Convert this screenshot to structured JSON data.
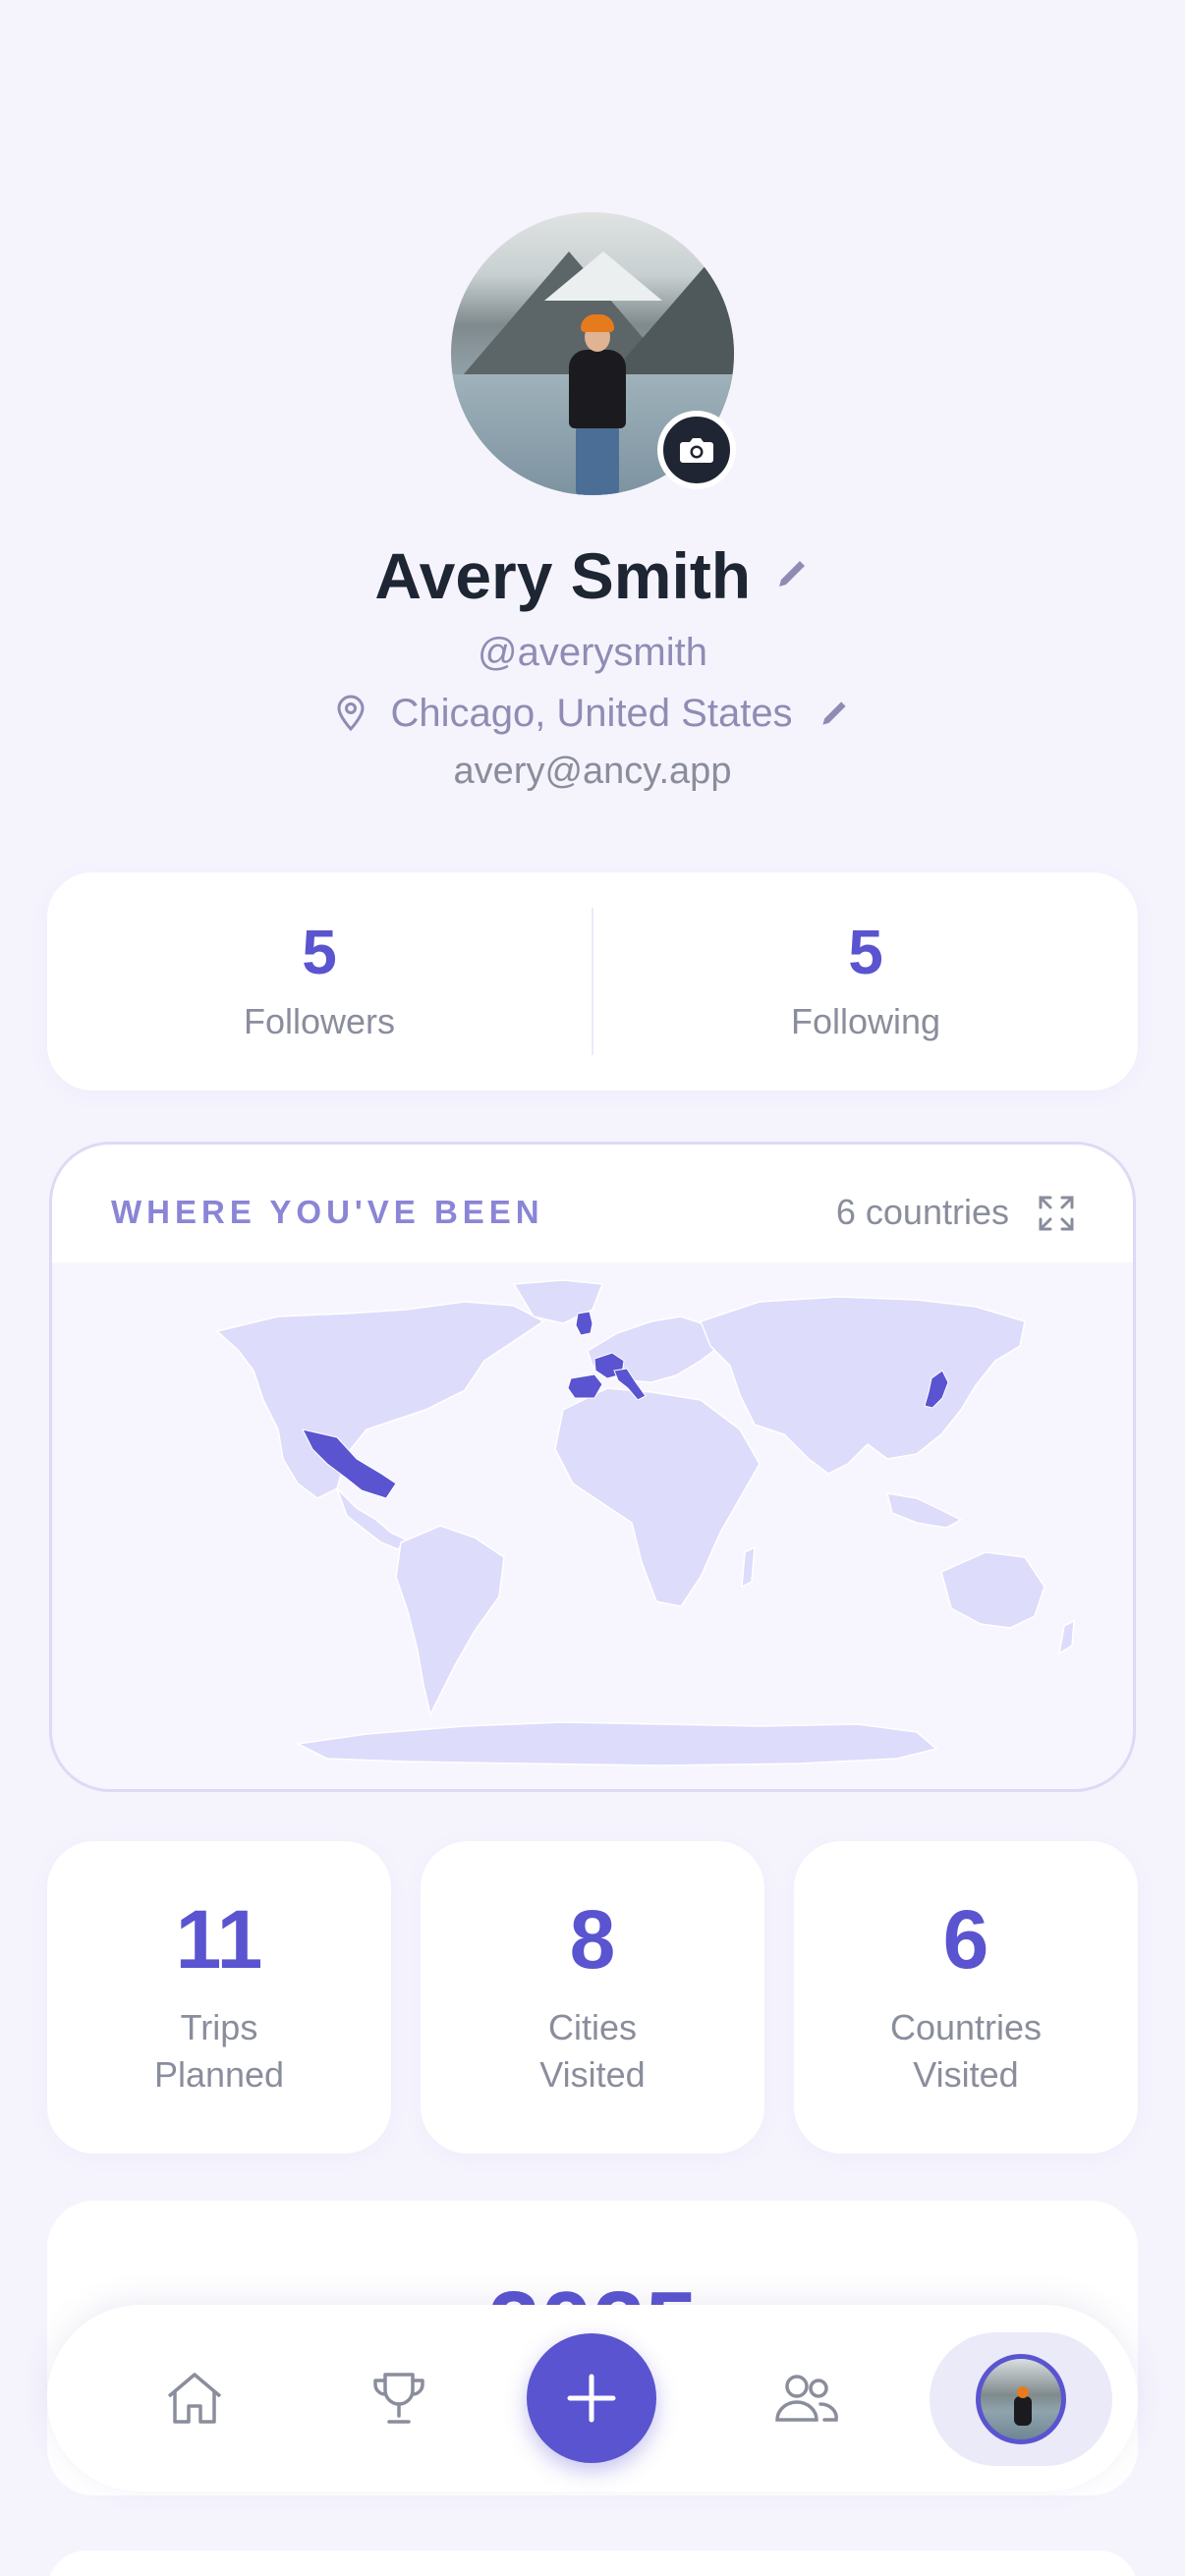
{
  "profile": {
    "name": "Avery Smith",
    "handle": "@averysmith",
    "location": "Chicago, United States",
    "email": "avery@ancy.app"
  },
  "social": {
    "followers_count": "5",
    "followers_label": "Followers",
    "following_count": "5",
    "following_label": "Following"
  },
  "map": {
    "title": "WHERE YOU'VE BEEN",
    "count_label": "6 countries",
    "visited_countries": [
      "Mexico",
      "United Kingdom",
      "France",
      "Spain",
      "Italy",
      "Japan"
    ],
    "land_color": "#dedcfb",
    "visited_color": "#5a54d0"
  },
  "stats": [
    {
      "value": "11",
      "line1": "Trips",
      "line2": "Planned"
    },
    {
      "value": "8",
      "line1": "Cities",
      "line2": "Visited"
    },
    {
      "value": "6",
      "line1": "Countries",
      "line2": "Visited"
    }
  ],
  "year": "2025",
  "nav": {
    "items": [
      "home-icon",
      "trophy-icon",
      "add-icon",
      "friends-icon",
      "profile-avatar"
    ],
    "active": "profile-avatar"
  },
  "colors": {
    "accent": "#5a54d0",
    "background": "#f5f4fd",
    "muted_text": "#8a8d9c"
  }
}
